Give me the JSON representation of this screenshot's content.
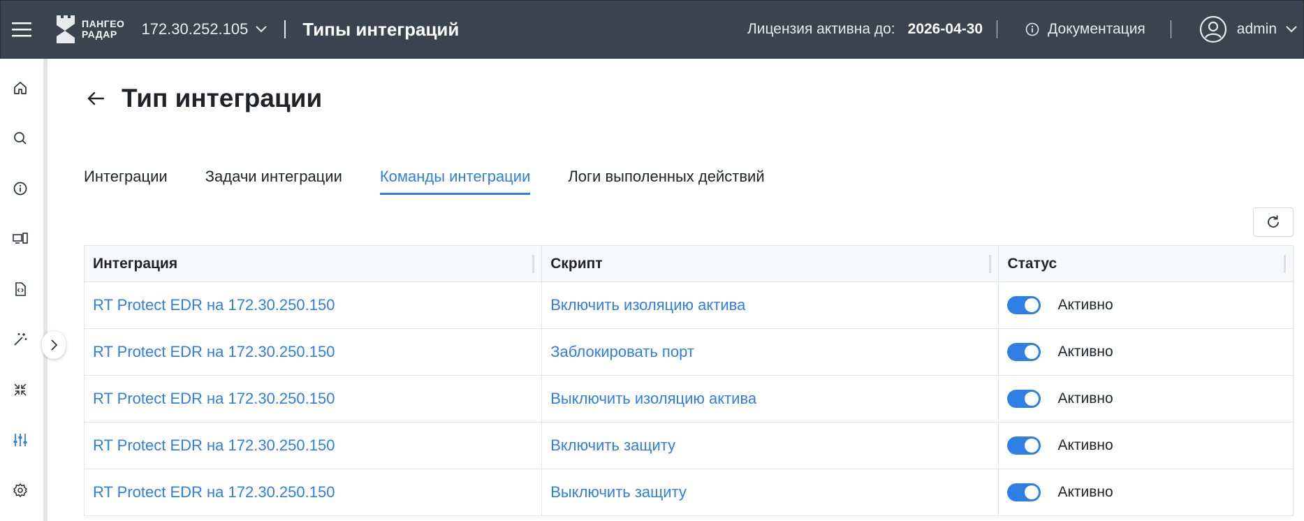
{
  "topbar": {
    "logo_line1": "ПАНГЕО",
    "logo_line2": "РАДАР",
    "host": "172.30.252.105",
    "title": "Типы интеграций",
    "license_label": "Лицензия активна до:",
    "license_date": "2026-04-30",
    "docs_label": "Документация",
    "user": "admin",
    "bg_color": "#3c4350"
  },
  "sidebar": {
    "items": [
      {
        "icon": "home-icon"
      },
      {
        "icon": "search-icon"
      },
      {
        "icon": "info-icon"
      },
      {
        "icon": "devices-icon"
      },
      {
        "icon": "code-file-icon"
      },
      {
        "icon": "magic-wand-icon"
      },
      {
        "icon": "collapse-arrows-icon"
      },
      {
        "icon": "sliders-icon",
        "active": true
      },
      {
        "icon": "gear-icon"
      }
    ]
  },
  "page": {
    "title": "Тип интеграции",
    "tabs": [
      {
        "label": "Интеграции",
        "active": false
      },
      {
        "label": "Задачи интеграции",
        "active": false
      },
      {
        "label": "Команды интеграции",
        "active": true
      },
      {
        "label": "Логи выполенных действий",
        "active": false
      }
    ],
    "accent_color": "#2f7ee6"
  },
  "table": {
    "columns": [
      "Интеграция",
      "Скрипт",
      "Статус"
    ],
    "rows": [
      {
        "integration": "RT Protect EDR на 172.30.250.150",
        "script": "Включить изоляцию актива",
        "status": "Активно",
        "enabled": true
      },
      {
        "integration": "RT Protect EDR на 172.30.250.150",
        "script": "Заблокировать порт",
        "status": "Активно",
        "enabled": true
      },
      {
        "integration": "RT Protect EDR на 172.30.250.150",
        "script": "Выключить изоляцию актива",
        "status": "Активно",
        "enabled": true
      },
      {
        "integration": "RT Protect EDR на 172.30.250.150",
        "script": "Включить защиту",
        "status": "Активно",
        "enabled": true
      },
      {
        "integration": "RT Protect EDR на 172.30.250.150",
        "script": "Выключить защиту",
        "status": "Активно",
        "enabled": true
      }
    ]
  }
}
